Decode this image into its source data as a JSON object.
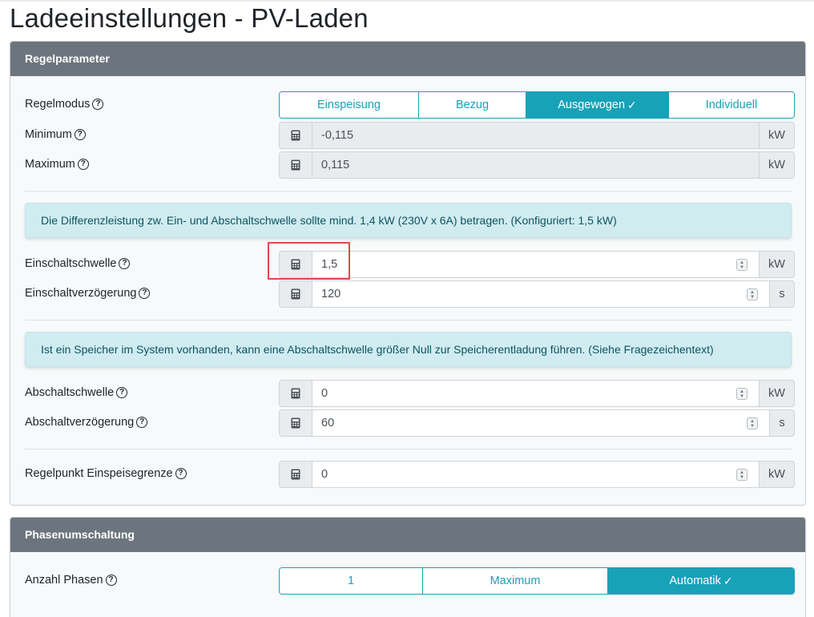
{
  "page": {
    "title": "Ladeeinstellungen - PV-Laden"
  },
  "regelparameter": {
    "header": "Regelparameter",
    "regelmodus": {
      "label": "Regelmodus",
      "options": [
        "Einspeisung",
        "Bezug",
        "Ausgewogen",
        "Individuell"
      ],
      "selected": "Ausgewogen"
    },
    "minimum": {
      "label": "Minimum",
      "value": "-0,115",
      "unit": "kW"
    },
    "maximum": {
      "label": "Maximum",
      "value": "0,115",
      "unit": "kW"
    },
    "info_differenz": "Die Differenzleistung zw. Ein- und Abschaltschwelle sollte mind. 1,4 kW (230V x 6A) betragen. (Konfiguriert: 1,5 kW)",
    "einschaltschwelle": {
      "label": "Einschaltschwelle",
      "value": "1,5",
      "unit": "kW"
    },
    "einschaltverzoegerung": {
      "label": "Einschaltverzögerung",
      "value": "120",
      "unit": "s"
    },
    "info_speicher": "Ist ein Speicher im System vorhanden, kann eine Abschaltschwelle größer Null zur Speicherentladung führen. (Siehe Fragezeichentext)",
    "abschaltschwelle": {
      "label": "Abschaltschwelle",
      "value": "0",
      "unit": "kW"
    },
    "abschaltverzoegerung": {
      "label": "Abschaltverzögerung",
      "value": "60",
      "unit": "s"
    },
    "regelpunkt": {
      "label": "Regelpunkt Einspeisegrenze",
      "value": "0",
      "unit": "kW"
    }
  },
  "phasenumschaltung": {
    "header": "Phasenumschaltung",
    "anzahl_phasen": {
      "label": "Anzahl Phasen",
      "options": [
        "1",
        "Maximum",
        "Automatik"
      ],
      "selected": "Automatik"
    }
  },
  "icons": {
    "help": "question-circle-icon",
    "calculator": "calculator-icon",
    "check": "check-icon",
    "spinner": "spinner-arrows-icon"
  },
  "colors": {
    "accent": "#17a2b8",
    "card_header": "#6c757d",
    "alert_bg": "#d1ecf1",
    "alert_text": "#0c5460",
    "highlight": "#e0474c"
  }
}
